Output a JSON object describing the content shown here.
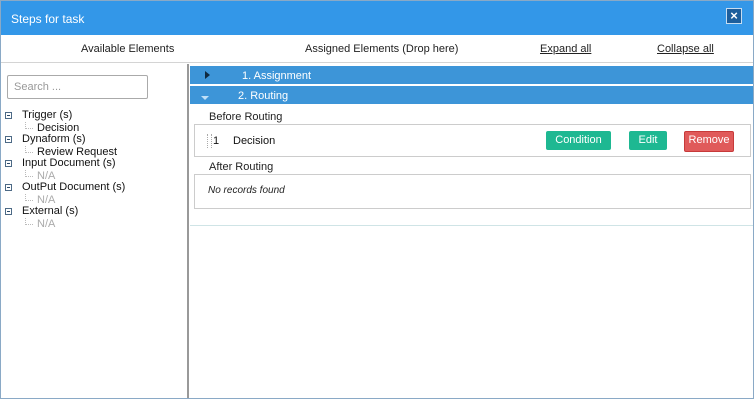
{
  "dialog": {
    "title": "Steps for task",
    "close_label": "×"
  },
  "header": {
    "available_label": "Available Elements",
    "assigned_label": "Assigned Elements (Drop here)",
    "expand_all": "Expand all",
    "collapse_all": "Collapse all"
  },
  "search": {
    "placeholder": "Search ..."
  },
  "tree": [
    {
      "label": "Trigger (s)",
      "children": [
        {
          "label": "Decision",
          "muted": false
        }
      ]
    },
    {
      "label": "Dynaform (s)",
      "children": [
        {
          "label": "Review Request",
          "muted": false
        }
      ]
    },
    {
      "label": "Input Document (s)",
      "children": [
        {
          "label": "N/A",
          "muted": true
        }
      ]
    },
    {
      "label": "OutPut Document (s)",
      "children": [
        {
          "label": "N/A",
          "muted": true
        }
      ]
    },
    {
      "label": "External (s)",
      "children": [
        {
          "label": "N/A",
          "muted": true
        }
      ]
    }
  ],
  "steps": [
    {
      "label": "1. Assignment",
      "expanded": false
    },
    {
      "label": "2. Routing",
      "expanded": true
    }
  ],
  "routing": {
    "before_label": "Before Routing",
    "after_label": "After Routing",
    "before_rows": [
      {
        "number": "1",
        "name": "Decision",
        "condition_label": "Condition",
        "edit_label": "Edit",
        "remove_label": "Remove"
      }
    ],
    "after_empty_text": "No records found"
  },
  "colors": {
    "title_bar": "#3397e8",
    "step_bar": "#3d95d8",
    "green_button": "#1eb892",
    "red_button": "#e05a5a"
  }
}
